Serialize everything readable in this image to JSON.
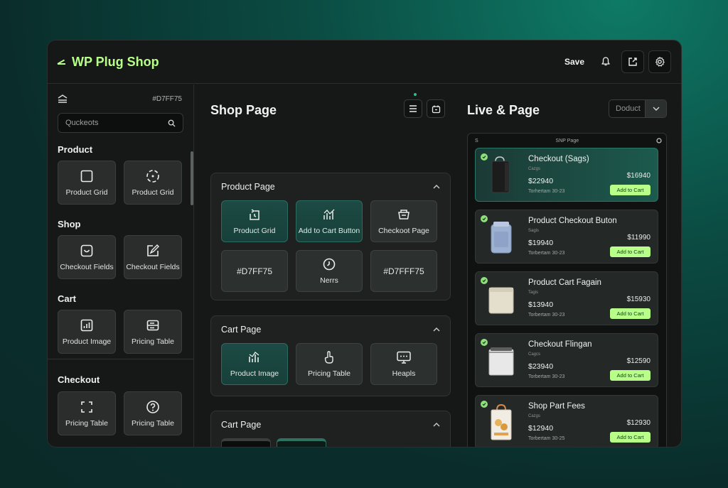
{
  "app": {
    "title": "WP Plug Shop",
    "save_label": "Save"
  },
  "sidebar": {
    "code": "#D7FF75",
    "search_placeholder": "Quckeots",
    "sections": [
      {
        "title": "Product",
        "items": [
          {
            "label": "Product Grid",
            "icon": "square-icon"
          },
          {
            "label": "Product Grid",
            "icon": "circle-dashed-icon"
          }
        ]
      },
      {
        "title": "Shop",
        "items": [
          {
            "label": "Checkout Fields",
            "icon": "smile-box-icon"
          },
          {
            "label": "Checkout Fields",
            "icon": "edit-box-icon"
          }
        ]
      },
      {
        "title": "Cart",
        "items": [
          {
            "label": "Product Image",
            "icon": "chart-box-icon"
          },
          {
            "label": "Pricing Table",
            "icon": "table-icon"
          }
        ]
      },
      {
        "title": "Checkout",
        "items": [
          {
            "label": "Pricing Table",
            "icon": "frame-icon"
          },
          {
            "label": "Pricing Table",
            "icon": "help-circle-icon"
          }
        ]
      }
    ]
  },
  "middle": {
    "title": "Shop Page",
    "panel1": {
      "title": "Product Page",
      "tiles": [
        {
          "label": "Product Grid",
          "icon": "refresh-doc-icon",
          "teal": true
        },
        {
          "label": "Add to Cart Button",
          "icon": "sparkle-chart-icon",
          "teal": true
        },
        {
          "label": "Checkoot Page",
          "icon": "basket-icon",
          "teal": false
        },
        {
          "label": "#D7FF75",
          "icon": "",
          "teal": false
        },
        {
          "label": "Nerrs",
          "icon": "timer-icon",
          "teal": false
        },
        {
          "label": "#D7FFF75",
          "icon": "",
          "teal": false
        }
      ]
    },
    "panel2": {
      "title": "Cart Page",
      "tiles": [
        {
          "label": "Product Image",
          "icon": "bar-chart-icon",
          "teal": true
        },
        {
          "label": "Pricing Table",
          "icon": "hand-icon",
          "teal": false
        },
        {
          "label": "Heapls",
          "icon": "monitor-icon",
          "teal": false
        }
      ]
    },
    "panel3": {
      "title": "Cart Page",
      "swatches": [
        "#020604",
        "#062F1F"
      ]
    }
  },
  "preview": {
    "title": "Live & Page",
    "select_value": "Doduct",
    "header_left": "S",
    "header_center": "SNP Page",
    "add_to_cart": "Add to Cart",
    "products": [
      {
        "name": "Checkout (Sags)",
        "sub": "Cazgs",
        "price": "$22940",
        "date": "Torhertam 30-23",
        "price2": "$16940",
        "thumb": "bag"
      },
      {
        "name": "Product Checkout Buton",
        "sub": "Sagis",
        "price": "$19940",
        "date": "Torbertam 30-23",
        "price2": "$11990",
        "thumb": "canister"
      },
      {
        "name": "Product Cart Fagain",
        "sub": "Tagis",
        "price": "$13940",
        "date": "Torbertam 30-23",
        "price2": "$15930",
        "thumb": "box"
      },
      {
        "name": "Checkout Flingan",
        "sub": "Cagcs",
        "price": "$23940",
        "date": "Torbertam 30-23",
        "price2": "$12590",
        "thumb": "folder"
      },
      {
        "name": "Shop Part Fees",
        "sub": "Cazgs",
        "price": "$12940",
        "date": "Torbertam 30-25",
        "price2": "$12930",
        "thumb": "shopping-bag"
      }
    ]
  }
}
